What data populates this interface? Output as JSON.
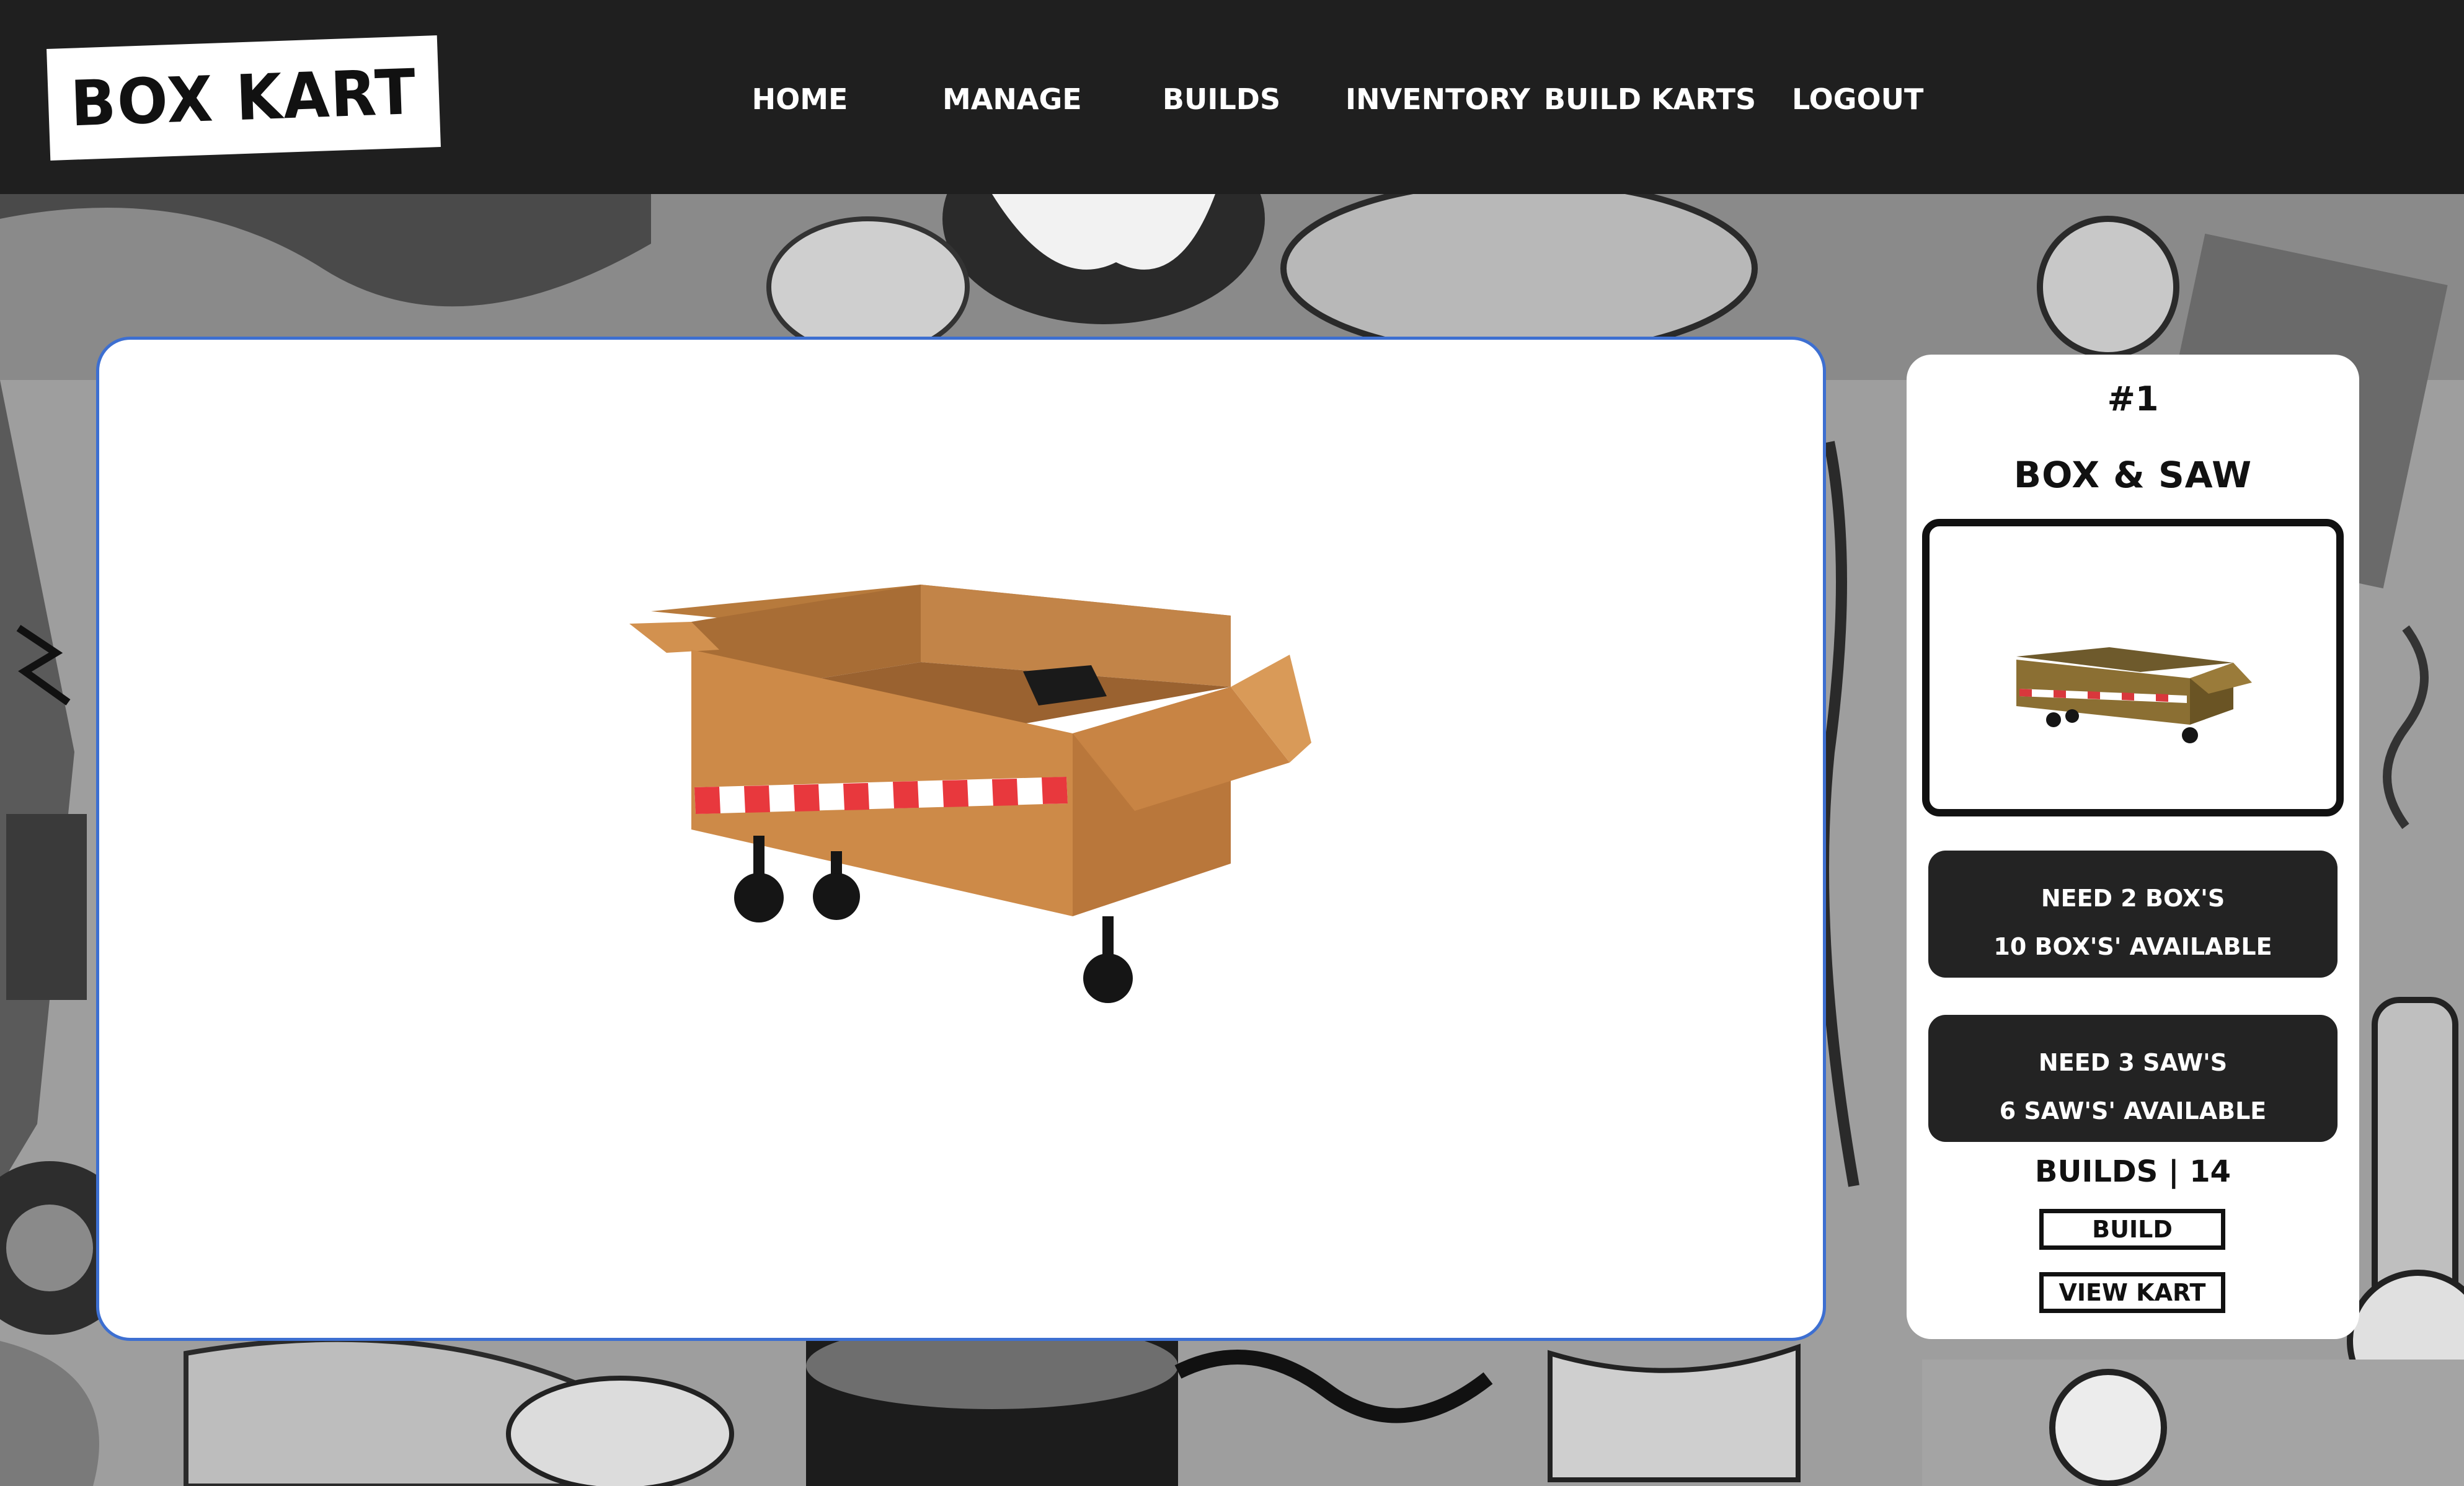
{
  "app": {
    "logo_text": "BOX KART"
  },
  "nav": {
    "items": [
      {
        "label": "Home"
      },
      {
        "label": "Manage"
      },
      {
        "label": "Builds"
      },
      {
        "label": "Inventory"
      },
      {
        "label": "Build Karts"
      },
      {
        "label": "Logout"
      }
    ]
  },
  "kart": {
    "number": "#1",
    "name": "Box & Saw",
    "requirements": [
      {
        "need": "Need 2 Box's",
        "available": "10 Box's' Available"
      },
      {
        "need": "Need 3 Saw's",
        "available": "6 Saw's' Available"
      }
    ],
    "builds_label": "Builds | 14",
    "build_button": "Build",
    "view_button": "View Kart"
  },
  "colors": {
    "header_bg": "#1f1f1f",
    "viewer_border": "#3d6fd1",
    "box_body": "#cd8a48",
    "tape_red": "#e8383d",
    "card_bg": "#232323"
  }
}
